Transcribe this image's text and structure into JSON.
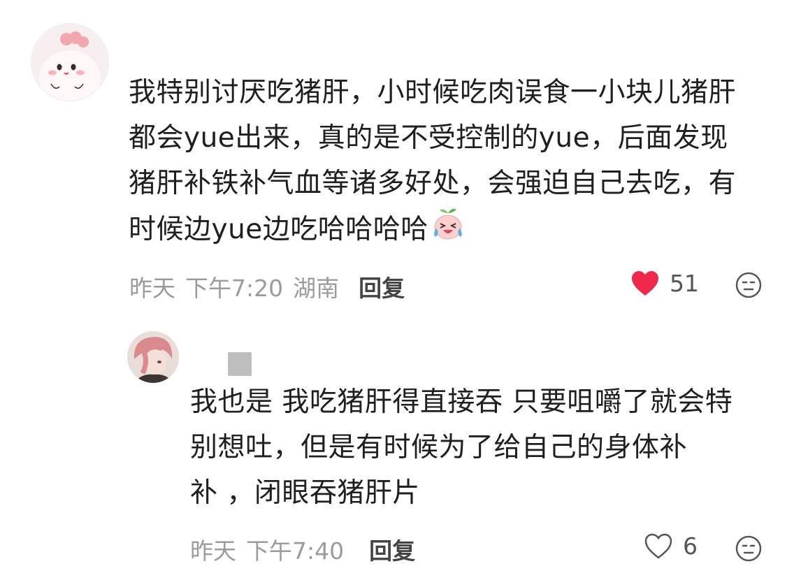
{
  "comment": {
    "lines": [
      "我特别讨厌吃猪肝，小时候吃肉误食一小块儿猪肝",
      "都会yue出来，真的是不受控制的yue，后面发现",
      "猪肝补铁补气血等诸多好处，会强迫自己去吃，有",
      "时候边yue边吃哈哈哈哈"
    ],
    "emoji": "laughing-crying-emoji",
    "date": "昨天",
    "time": "下午7:20",
    "location": "湖南",
    "reply_label": "回复",
    "likes": "51",
    "liked": true,
    "like_color": "#f0284a"
  },
  "reply": {
    "lines": [
      "我也是 我吃猪肝得直接吞 只要咀嚼了就会特",
      "别想吐，但是有时候为了给自己的身体补",
      "补 ，闭眼吞猪肝片"
    ],
    "date": "昨天",
    "time": "下午7:40",
    "reply_label": "回复",
    "likes": "6",
    "liked": false
  }
}
